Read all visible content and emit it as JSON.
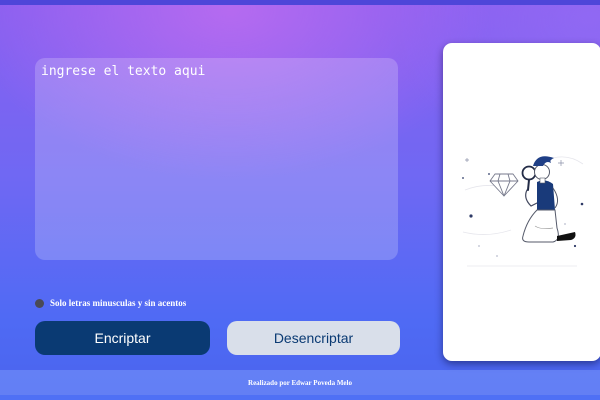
{
  "input": {
    "placeholder": "ingrese el texto aqui",
    "value": ""
  },
  "info": {
    "icon": "info-icon",
    "text": "Solo letras minusculas y sin acentos"
  },
  "buttons": {
    "encrypt_label": "Encriptar",
    "decrypt_label": "Desencriptar"
  },
  "side_panel": {
    "illustration": "person-with-magnifying-glass-diamond-illustration"
  },
  "footer": {
    "text": "Realizado por Edwar Poveda Melo"
  },
  "colors": {
    "primary_button": "#0a3a73",
    "secondary_button": "#d9dfea",
    "panel_background": "#ffffff"
  }
}
